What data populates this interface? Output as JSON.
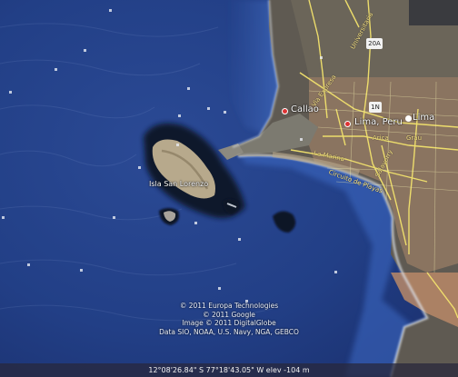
{
  "places": {
    "callao": "Callao",
    "lima": "Lima, Peru",
    "lima_short": "Lima",
    "island": "Isla San Lorenzo"
  },
  "roads": {
    "shield_20a": "20A",
    "shield_1n": "1N",
    "arica": "Arica",
    "grau": "Grau",
    "la_marina": "La Marina",
    "salaverry": "Salaverry",
    "circuito_playas": "Circuito de Playas",
    "via_expresa": "Via Expresa",
    "universitaria": "Universitaria"
  },
  "attribution": {
    "line1": "© 2011 Europa Technologies",
    "line2": "© 2011 Google",
    "line3": "Image © 2011 DigitalGlobe",
    "line4": "Data SIO, NOAA, U.S. Navy, NGA, GEBCO"
  },
  "status": {
    "coordinates": "12°08'26.84\" S   77°18'43.05\" W   elev  -104 m"
  },
  "colors": {
    "ocean": "#1f3a7c",
    "land": "#8a7460",
    "highlight": "#b88867"
  }
}
